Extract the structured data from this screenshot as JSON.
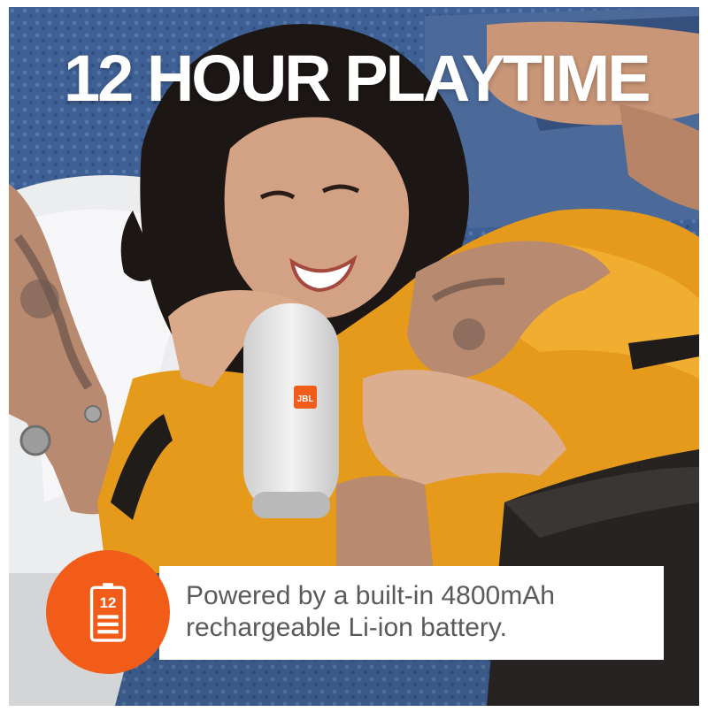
{
  "headline": "12 HOUR PLAYTIME",
  "info": {
    "line1": "Powered by a built-in 4800mAh",
    "line2": "rechargeable Li-ion battery."
  },
  "speaker": {
    "logo": "JBL"
  },
  "battery_icon": {
    "name": "battery-icon",
    "label": "12"
  },
  "colors": {
    "accent": "#f25c19",
    "background": "#3d5f93",
    "sweater": "#e59a1c",
    "text": "#5a5a5a"
  }
}
